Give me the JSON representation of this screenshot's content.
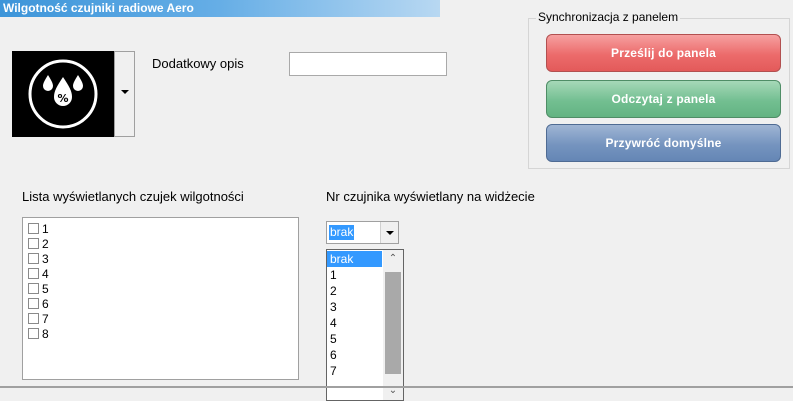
{
  "header": {
    "title": "Wilgotność czujniki radiowe Aero"
  },
  "icon": {
    "name": "humidity-percent-icon"
  },
  "description": {
    "label": "Dodatkowy opis",
    "value": ""
  },
  "sync": {
    "legend": "Synchronizacja z panelem",
    "send_label": "Prześlij do panela",
    "read_label": "Odczytaj z panela",
    "restore_label": "Przywróć domyślne",
    "colors": {
      "send": "#ec6b6b",
      "read": "#73bf91",
      "restore": "#7594bf"
    }
  },
  "sensor_list": {
    "label": "Lista wyświetlanych czujek wilgotności",
    "items": [
      "1",
      "2",
      "3",
      "4",
      "5",
      "6",
      "7",
      "8"
    ]
  },
  "widget_sensor": {
    "label": "Nr czujnika wyświetlany na widżecie",
    "selected": "brak",
    "options": [
      "brak",
      "1",
      "2",
      "3",
      "4",
      "5",
      "6",
      "7"
    ]
  }
}
